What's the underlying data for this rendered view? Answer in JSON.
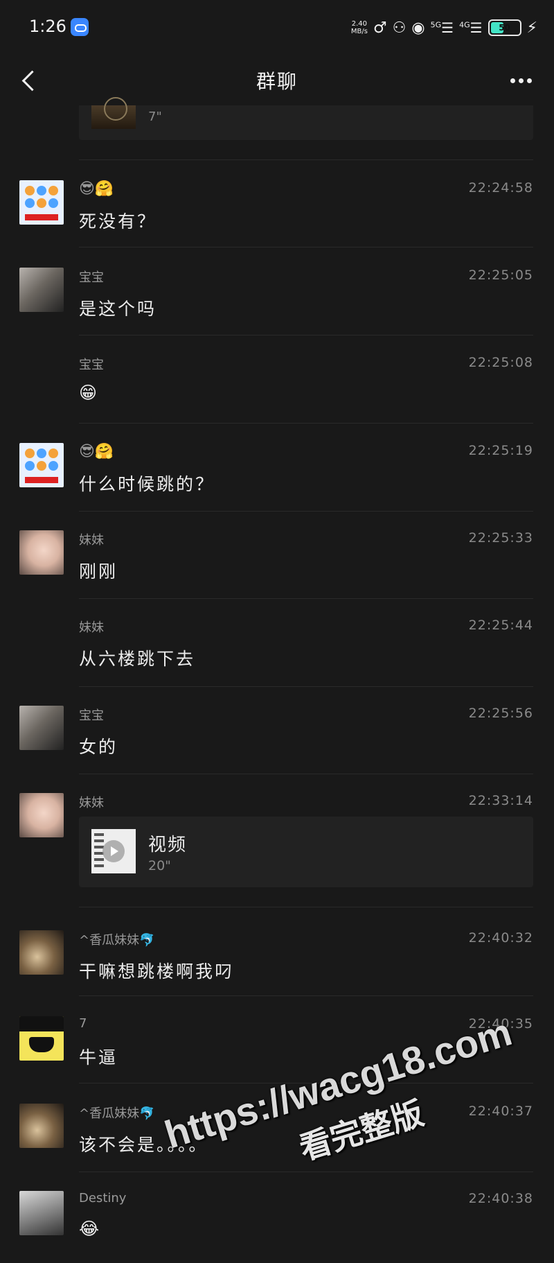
{
  "status_bar": {
    "time": "1:26",
    "speed": "2.40",
    "speed_unit": "MB/s",
    "net1": "5G",
    "net2": "4G",
    "battery": "50"
  },
  "header": {
    "title": "群聊"
  },
  "top_card": {
    "duration": "7\""
  },
  "messages": [
    {
      "sender": "😎🤗",
      "time": "22:24:58",
      "text": "死没有？"
    },
    {
      "sender": "宝宝",
      "time": "22:25:05",
      "text": "是这个吗"
    },
    {
      "sender": "宝宝",
      "time": "22:25:08",
      "text": "😁"
    },
    {
      "sender": "😎🤗",
      "time": "22:25:19",
      "text": "什么时候跳的？"
    },
    {
      "sender": "妹妹",
      "time": "22:25:33",
      "text": "刚刚"
    },
    {
      "sender": "妹妹",
      "time": "22:25:44",
      "text": "从六楼跳下去"
    },
    {
      "sender": "宝宝",
      "time": "22:25:56",
      "text": "女的"
    },
    {
      "sender": "妹妹",
      "time": "22:33:14",
      "video_title": "视频",
      "video_duration": "20\""
    },
    {
      "sender": "^香瓜妹妹🐬",
      "time": "22:40:32",
      "text": "干嘛想跳楼啊我叼"
    },
    {
      "sender": "7",
      "time": "22:40:35",
      "text": "牛逼"
    },
    {
      "sender": "^香瓜妹妹🐬",
      "time": "22:40:37",
      "text": "该不会是。。。。"
    },
    {
      "sender": "Destiny",
      "time": "22:40:38",
      "text": "😂"
    }
  ],
  "watermark": {
    "url": "https://wacg18.com",
    "caption": "看完整版"
  }
}
